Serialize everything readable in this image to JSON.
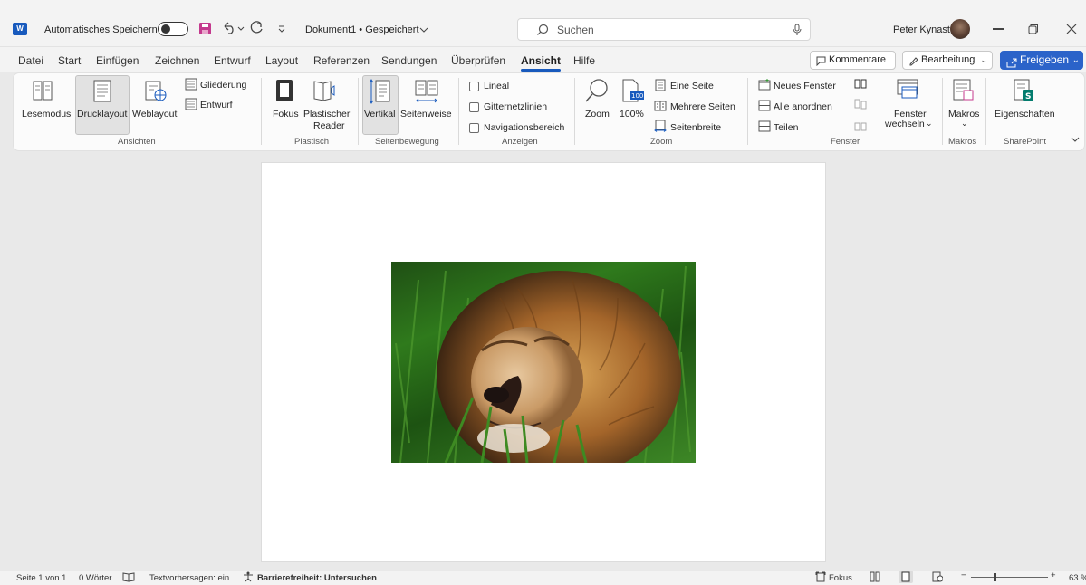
{
  "titlebar": {
    "app_logo": "W",
    "autosave_label": "Automatisches Speichern",
    "document_name": "Dokument1 • Gespeichert",
    "search_placeholder": "Suchen",
    "user_name": "Peter Kynast",
    "icons": [
      "word-logo-icon",
      "save-icon",
      "undo-icon",
      "redo-icon",
      "customize-quick-access-icon",
      "microphone-icon",
      "minimize-icon",
      "restore-icon",
      "close-icon"
    ]
  },
  "tabs": [
    "Datei",
    "Start",
    "Einfügen",
    "Zeichnen",
    "Entwurf",
    "Layout",
    "Referenzen",
    "Sendungen",
    "Überprüfen",
    "Ansicht",
    "Hilfe"
  ],
  "active_tab": "Ansicht",
  "tab_actions": {
    "comments": "Kommentare",
    "editing": "Bearbeitung",
    "share": "Freigeben"
  },
  "ribbon": {
    "ansichten": {
      "group": "Ansichten",
      "lesemodus": "Lesemodus",
      "drucklayout": "Drucklayout",
      "weblayout": "Weblayout",
      "gliederung": "Gliederung",
      "entwurf": "Entwurf"
    },
    "plastisch": {
      "group": "Plastisch",
      "fokus": "Fokus",
      "reader_line1": "Plastischer",
      "reader_line2": "Reader"
    },
    "seitenbewegung": {
      "group": "Seitenbewegung",
      "vertikal": "Vertikal",
      "seitenweise": "Seitenweise"
    },
    "anzeigen": {
      "group": "Anzeigen",
      "lineal": "Lineal",
      "gitternetzlinien": "Gitternetzlinien",
      "navigationsbereich": "Navigationsbereich"
    },
    "zoom": {
      "group": "Zoom",
      "zoom": "Zoom",
      "hundred": "100%",
      "eine_seite": "Eine Seite",
      "mehrere_seiten": "Mehrere Seiten",
      "seitenbreite": "Seitenbreite"
    },
    "fenster": {
      "group": "Fenster",
      "neues_fenster": "Neues Fenster",
      "alle_anordnen": "Alle anordnen",
      "teilen": "Teilen",
      "fenster_wechseln_line1": "Fenster",
      "fenster_wechseln_line2": "wechseln"
    },
    "makros": {
      "group": "Makros",
      "makros": "Makros"
    },
    "sharepoint": {
      "group": "SharePoint",
      "eigenschaften": "Eigenschaften"
    }
  },
  "document": {
    "image_subject": "lion"
  },
  "statusbar": {
    "page": "Seite 1 von 1",
    "words": "0 Wörter",
    "text_predictions": "Textvorhersagen: ein",
    "accessibility": "Barrierefreiheit: Untersuchen",
    "focus": "Fokus",
    "zoom_level": "63 %"
  }
}
